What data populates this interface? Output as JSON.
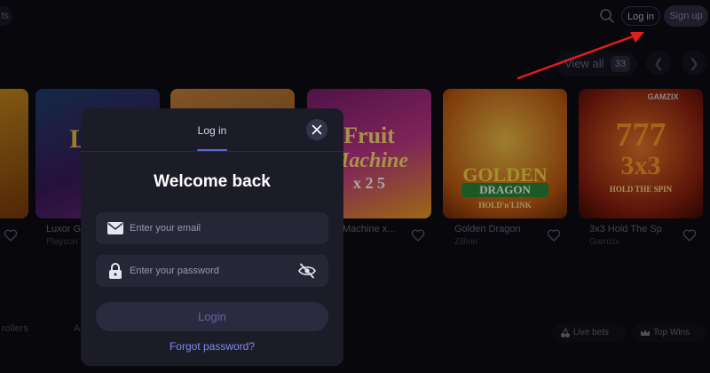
{
  "header": {
    "left_chip": "ts",
    "search_icon": "search-icon",
    "login_label": "Log in",
    "signup_label": "Sign up"
  },
  "games_section": {
    "view_all_label": "View all",
    "view_all_count": "33",
    "games": [
      {
        "name": "",
        "provider": ""
      },
      {
        "name": "Luxor G",
        "provider": "Playson"
      },
      {
        "name": "",
        "provider": ""
      },
      {
        "name": "Machine x...",
        "provider": ""
      },
      {
        "name": "Golden Dragon",
        "provider": "Zillion"
      },
      {
        "name": "3x3 Hold The Sp",
        "provider": "Gamzix"
      }
    ],
    "card_art": {
      "fruit_top": "Fruit",
      "fruit_mid": "Machine",
      "fruit_bottom": "x 2 5",
      "dragon_top": "GOLDEN",
      "dragon_mid": "DRAGON",
      "dragon_bottom": "HOLD'n'LINK",
      "gamzix_big": "777",
      "gamzix_mid": "3x3",
      "gamzix_sub": "HOLD THE SPIN",
      "gamzix_badge": "GAMZIX",
      "luxor_text": "LUX"
    }
  },
  "bottom_tabs": {
    "tab_1": "rollers",
    "tab_2": "A",
    "live_bets": "Live bets",
    "top_wins": "Top Wins"
  },
  "modal": {
    "tab_label": "Log in",
    "title": "Welcome back",
    "email_placeholder": "Enter your email",
    "password_placeholder": "Enter your password",
    "login_button": "Login",
    "forgot_link": "Forgot password?"
  },
  "colors": {
    "background": "#0b0b13",
    "modal_bg": "#1c1c29",
    "accent": "#7f8cf0",
    "annotation_arrow": "#e01e1e"
  }
}
